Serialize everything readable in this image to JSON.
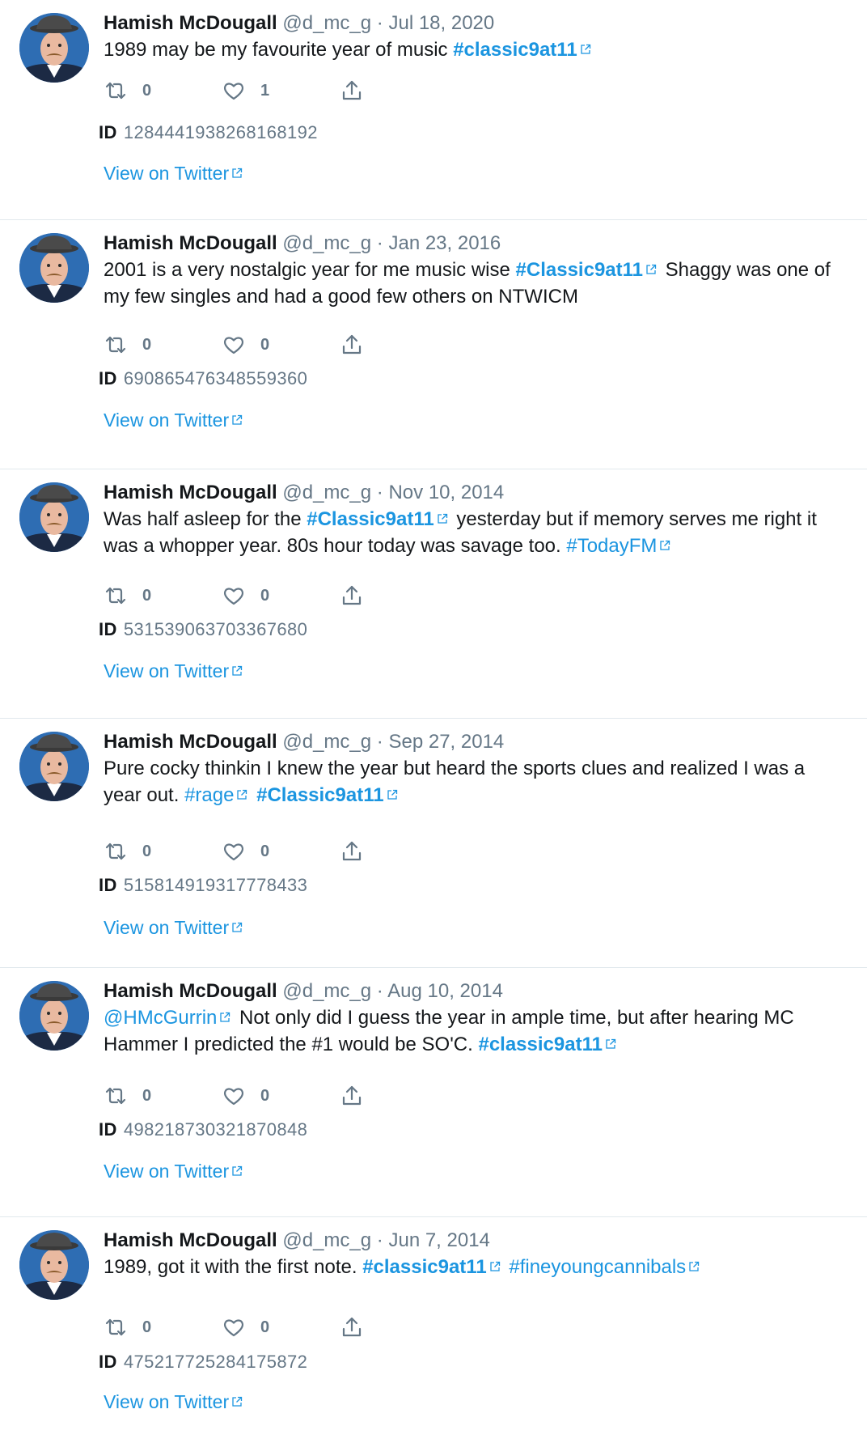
{
  "user": {
    "name": "Hamish McDougall",
    "handle": "@d_mc_g",
    "separator": "·"
  },
  "view_label": "View on Twitter",
  "id_label": "ID",
  "icons": {
    "retweet": "retweet-icon",
    "like": "heart-icon",
    "share": "share-icon",
    "external": "external-link-icon"
  },
  "colors": {
    "link": "#1b95e0",
    "muted": "#657786",
    "text": "#14171a",
    "divider": "#e1e8ed"
  },
  "tweets": [
    {
      "date": "Jul 18, 2020",
      "segments": [
        {
          "t": "text",
          "v": "1989 may be my favourite year of music "
        },
        {
          "t": "hashtag",
          "v": "#classic9at11",
          "bold": true
        }
      ],
      "retweets": "0",
      "likes": "1",
      "id": "1284441938268168192"
    },
    {
      "date": "Jan 23, 2016",
      "segments": [
        {
          "t": "text",
          "v": "2001 is a very nostalgic year for me music wise "
        },
        {
          "t": "hashtag",
          "v": "#Classic9at11",
          "bold": true
        },
        {
          "t": "text",
          "v": " Shaggy was one of my few singles and had a good few others on NTWICM"
        }
      ],
      "retweets": "0",
      "likes": "0",
      "id": "690865476348559360"
    },
    {
      "date": "Nov 10, 2014",
      "segments": [
        {
          "t": "text",
          "v": "Was half asleep for the "
        },
        {
          "t": "hashtag",
          "v": "#Classic9at11",
          "bold": true
        },
        {
          "t": "text",
          "v": " yesterday but if memory serves me right it was a whopper year. 80s hour today was savage too. "
        },
        {
          "t": "hashtag",
          "v": "#TodayFM",
          "bold": false
        }
      ],
      "retweets": "0",
      "likes": "0",
      "id": "531539063703367680"
    },
    {
      "date": "Sep 27, 2014",
      "segments": [
        {
          "t": "text",
          "v": "Pure cocky thinkin I knew the year but heard the sports clues and realized I was a year out. "
        },
        {
          "t": "hashtag",
          "v": "#rage",
          "bold": false
        },
        {
          "t": "text",
          "v": " "
        },
        {
          "t": "hashtag",
          "v": "#Classic9at11",
          "bold": true
        }
      ],
      "retweets": "0",
      "likes": "0",
      "id": "515814919317778433"
    },
    {
      "date": "Aug 10, 2014",
      "segments": [
        {
          "t": "mention",
          "v": "@HMcGurrin"
        },
        {
          "t": "text",
          "v": " Not only did I guess the year in ample time, but after hearing MC Hammer I predicted the #1 would be SO'C. "
        },
        {
          "t": "hashtag",
          "v": "#classic9at11",
          "bold": true
        }
      ],
      "retweets": "0",
      "likes": "0",
      "id": "498218730321870848"
    },
    {
      "date": "Jun 7, 2014",
      "segments": [
        {
          "t": "text",
          "v": "1989, got it with the first note. "
        },
        {
          "t": "hashtag",
          "v": "#classic9at11",
          "bold": true
        },
        {
          "t": "text",
          "v": " "
        },
        {
          "t": "hashtag",
          "v": "#fineyoungcannibals",
          "bold": false
        }
      ],
      "retweets": "0",
      "likes": "0",
      "id": "475217725284175872"
    }
  ]
}
